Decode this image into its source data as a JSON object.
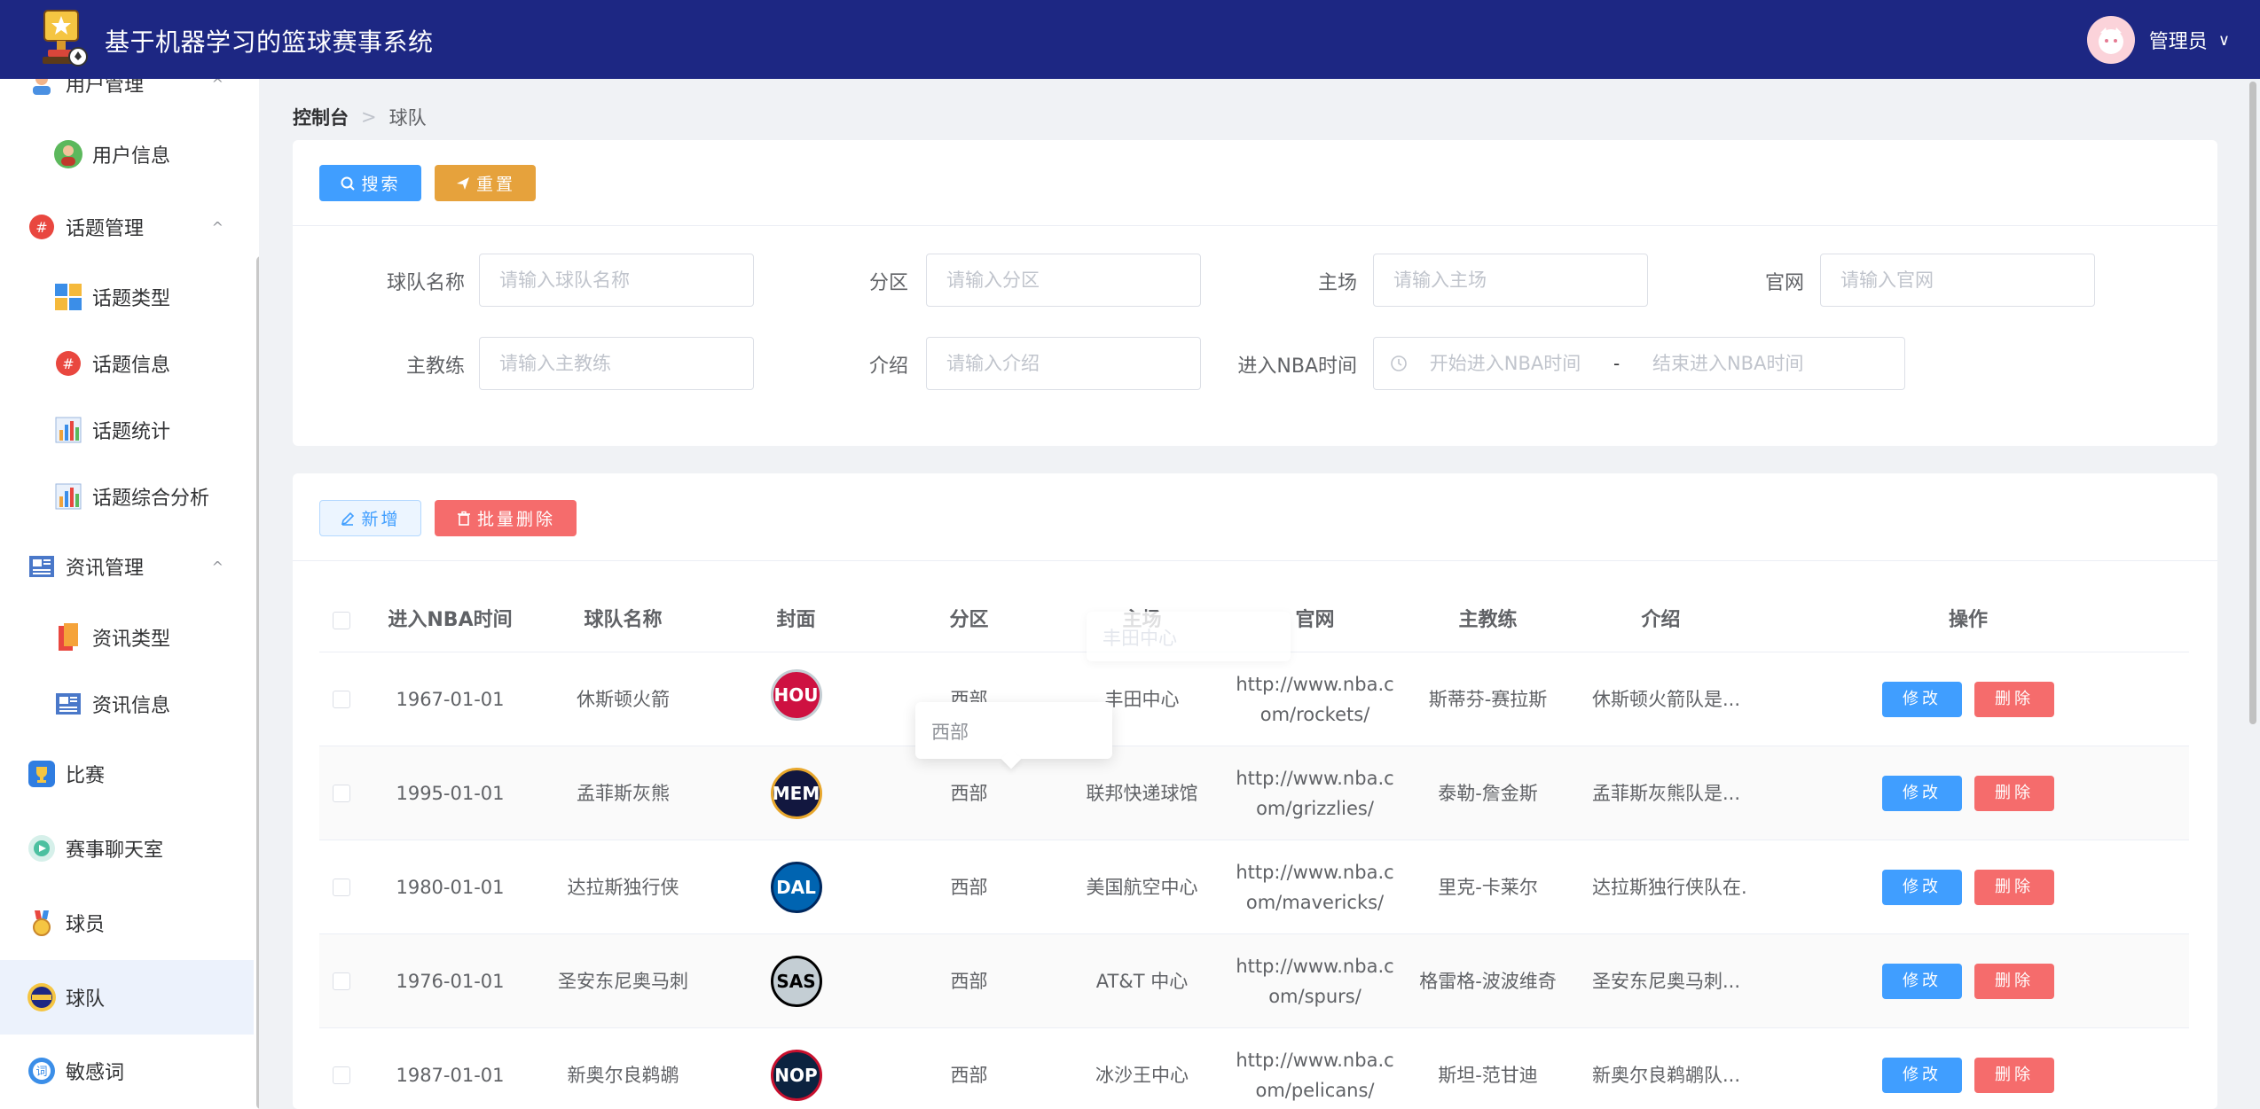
{
  "app": {
    "title": "基于机器学习的篮球赛事系统"
  },
  "user": {
    "name": "管理员",
    "caret": "∨"
  },
  "sidebar": {
    "items": [
      {
        "label": "用户管理",
        "caret": "^"
      },
      {
        "label": "用户信息"
      },
      {
        "label": "话题管理",
        "caret": "^"
      },
      {
        "label": "话题类型"
      },
      {
        "label": "话题信息"
      },
      {
        "label": "话题统计"
      },
      {
        "label": "话题综合分析"
      },
      {
        "label": "资讯管理",
        "caret": "^"
      },
      {
        "label": "资讯类型"
      },
      {
        "label": "资讯信息"
      },
      {
        "label": "比赛"
      },
      {
        "label": "赛事聊天室"
      },
      {
        "label": "球员"
      },
      {
        "label": "球队"
      },
      {
        "label": "敏感词"
      }
    ]
  },
  "breadcrumb": {
    "home": "控制台",
    "separator": ">",
    "current": "球队"
  },
  "search": {
    "search_button": "搜索",
    "reset_button": "重置",
    "fields": {
      "team_name": {
        "label": "球队名称",
        "placeholder": "请输入球队名称"
      },
      "division": {
        "label": "分区",
        "placeholder": "请输入分区"
      },
      "home": {
        "label": "主场",
        "placeholder": "请输入主场"
      },
      "website": {
        "label": "官网",
        "placeholder": "请输入官网"
      },
      "coach": {
        "label": "主教练",
        "placeholder": "请输入主教练"
      },
      "intro": {
        "label": "介绍",
        "placeholder": "请输入介绍"
      },
      "nba_time": {
        "label": "进入NBA时间",
        "start_placeholder": "开始进入NBA时间",
        "end_placeholder": "结束进入NBA时间",
        "separator": "-"
      }
    }
  },
  "toolbar": {
    "add_button": "新增",
    "batch_delete_button": "批量删除"
  },
  "table": {
    "headers": {
      "nba_time": "进入NBA时间",
      "team_name": "球队名称",
      "cover": "封面",
      "division": "分区",
      "home": "主场",
      "website": "官网",
      "coach": "主教练",
      "intro": "介绍",
      "actions": "操作"
    },
    "edit_label": "修改",
    "delete_label": "删除",
    "rows": [
      {
        "nba_time": "1967-01-01",
        "team_name": "休斯顿火箭",
        "logo_text": "HOU",
        "division": "西部",
        "home": "丰田中心",
        "website": "http://www.nba.com/rockets/",
        "coach": "斯蒂芬-赛拉斯",
        "intro": "休斯顿火箭队是..."
      },
      {
        "nba_time": "1995-01-01",
        "team_name": "孟菲斯灰熊",
        "logo_text": "MEM",
        "division": "西部",
        "home": "联邦快递球馆",
        "website": "http://www.nba.com/grizzlies/",
        "coach": "泰勒-詹金斯",
        "intro": "孟菲斯灰熊队是..."
      },
      {
        "nba_time": "1980-01-01",
        "team_name": "达拉斯独行侠",
        "logo_text": "DAL",
        "division": "西部",
        "home": "美国航空中心",
        "website": "http://www.nba.com/mavericks/",
        "coach": "里克-卡莱尔",
        "intro": "达拉斯独行侠队在..."
      },
      {
        "nba_time": "1976-01-01",
        "team_name": "圣安东尼奥马刺",
        "logo_text": "SAS",
        "division": "西部",
        "home": "AT&T 中心",
        "website": "http://www.nba.com/spurs/",
        "coach": "格雷格-波波维奇",
        "intro": "圣安东尼奥马刺..."
      },
      {
        "nba_time": "1987-01-01",
        "team_name": "新奥尔良鹈鹕",
        "logo_text": "NOP",
        "division": "西部",
        "home": "冰沙王中心",
        "website": "http://www.nba.com/pelicans/",
        "coach": "斯坦-范甘迪",
        "intro": "新奥尔良鹈鹕队..."
      }
    ]
  },
  "tooltip": {
    "text": "西部"
  },
  "ghost_tooltip": {
    "text": "丰田中心"
  },
  "colors": {
    "header_bg": "#1d2783",
    "primary": "#409eff",
    "warning": "#e6a23c",
    "danger": "#f56c6c",
    "active_menu_bg": "#ecf2fc"
  },
  "icons": {
    "logo": "trophy-icon",
    "search_button": "search-icon",
    "reset_button": "send-icon",
    "add_button": "edit-icon",
    "batch_delete_button": "trash-icon",
    "date_range": "clock-icon"
  }
}
